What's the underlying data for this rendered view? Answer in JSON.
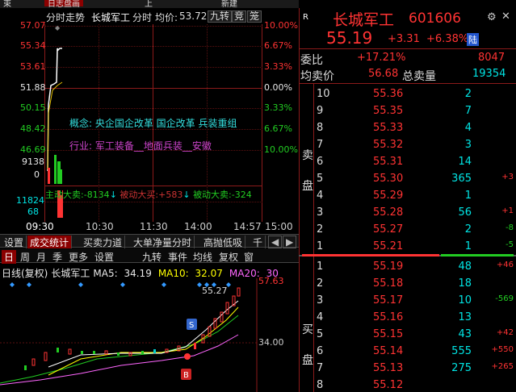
{
  "top_tabs": [
    "束",
    "日志盘画",
    "上",
    " ",
    "新建"
  ],
  "intraday": {
    "title": "分时走势",
    "name": "长城军工",
    "period": "分时",
    "avg_label": "均价:",
    "avg_value": "53.72",
    "btn_jiuzhuan": "九转",
    "btn_jing": "竞",
    "btn_long": "笼",
    "price_left": [
      "57.07",
      "55.34",
      "53.61",
      "51.88",
      "50.15",
      "48.42",
      "46.69"
    ],
    "pct_right": [
      "10.00%",
      "6.67%",
      "3.33%",
      "0.00%",
      "3.33%",
      "6.67%",
      "10.00%"
    ],
    "vol_left": [
      "9138",
      "0",
      "11824",
      "68"
    ],
    "concept": "概念: 央企国企改革  国企改革  兵装重组",
    "industry": "行业: 军工装备__地面兵装__安徽",
    "flow_main_label": "主动大卖:",
    "flow_main_value": "-8134",
    "flow_passive1_label": "被动大买:",
    "flow_passive1_value": "+583",
    "flow_passive2_label": "被动大卖:",
    "flow_passive2_value": "-324",
    "times": [
      "09:30",
      "10:30",
      "11:30",
      "14:00",
      "14:57",
      "15:00"
    ]
  },
  "tabrow1": [
    "设置",
    "成交统计",
    "买卖力道",
    "大单净量分时",
    "高抛低吸",
    "千"
  ],
  "tabrow2": [
    "日",
    "周",
    "月",
    "季",
    "更多",
    "设置",
    "九转",
    "事件",
    "均线",
    "复权",
    "窗"
  ],
  "daily": {
    "name": "日线(复权)",
    "code_name": "长城军工",
    "ma5_label": "MA5:",
    "ma5": "34.19",
    "ma10_label": "MA10:",
    "ma10": "32.07",
    "ma20_label": "MA20:",
    "ma20": "30",
    "high_label": "57.63",
    "mid_label": "34.00",
    "last_label": "55.27",
    "s_label": "S",
    "b_label": "B"
  },
  "quote": {
    "r": "R",
    "name": "长城军工",
    "code": "601606",
    "price": "55.19",
    "change": "+3.31",
    "pct": "+6.38%",
    "tag": "陆",
    "weibi_label": "委比",
    "weibi": "+17.21%",
    "weicha": "8047",
    "avg_label": "均卖价",
    "avg": "56.68",
    "total_label": "总卖量",
    "total": "19354",
    "sell_label1": "卖",
    "sell_label2": "盘",
    "buy_label1": "买",
    "buy_label2": "盘",
    "sells": [
      {
        "lvl": "10",
        "price": "55.36",
        "vol": "2",
        "chg": ""
      },
      {
        "lvl": "9",
        "price": "55.35",
        "vol": "7",
        "chg": ""
      },
      {
        "lvl": "8",
        "price": "55.33",
        "vol": "4",
        "chg": ""
      },
      {
        "lvl": "7",
        "price": "55.32",
        "vol": "3",
        "chg": ""
      },
      {
        "lvl": "6",
        "price": "55.31",
        "vol": "14",
        "chg": ""
      },
      {
        "lvl": "5",
        "price": "55.30",
        "vol": "365",
        "chg": "+3"
      },
      {
        "lvl": "4",
        "price": "55.29",
        "vol": "1",
        "chg": ""
      },
      {
        "lvl": "3",
        "price": "55.28",
        "vol": "56",
        "chg": "+1"
      },
      {
        "lvl": "2",
        "price": "55.27",
        "vol": "2",
        "chg": "-8"
      },
      {
        "lvl": "1",
        "price": "55.21",
        "vol": "1",
        "chg": "-5"
      }
    ],
    "buys": [
      {
        "lvl": "1",
        "price": "55.19",
        "vol": "48",
        "chg": "+46"
      },
      {
        "lvl": "2",
        "price": "55.18",
        "vol": "18",
        "chg": ""
      },
      {
        "lvl": "3",
        "price": "55.17",
        "vol": "10",
        "chg": "-569"
      },
      {
        "lvl": "4",
        "price": "55.16",
        "vol": "13",
        "chg": ""
      },
      {
        "lvl": "5",
        "price": "55.15",
        "vol": "43",
        "chg": "+42"
      },
      {
        "lvl": "6",
        "price": "55.14",
        "vol": "555",
        "chg": "+550"
      },
      {
        "lvl": "7",
        "price": "55.13",
        "vol": "275",
        "chg": "+265"
      },
      {
        "lvl": "8",
        "price": "55.12",
        "vol": "",
        "chg": ""
      }
    ]
  }
}
